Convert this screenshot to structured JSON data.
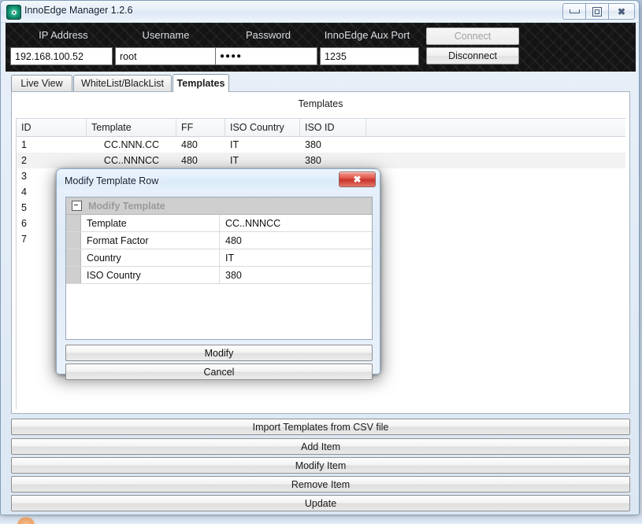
{
  "window": {
    "title": "InnoEdge Manager 1.2.6",
    "icon": "eye-icon",
    "controls": {
      "minimize": "minimize-icon",
      "maximize": "restore-icon",
      "close": "close-icon"
    }
  },
  "connection": {
    "fields": [
      {
        "label": "IP Address",
        "value": "192.168.100.52",
        "name": "ip-address"
      },
      {
        "label": "Username",
        "value": "root",
        "name": "username"
      },
      {
        "label": "Password",
        "value": "●●●●",
        "name": "password"
      },
      {
        "label": "InnoEdge Aux Port",
        "value": "1235",
        "name": "aux-port"
      }
    ],
    "connect_label": "Connect",
    "connect_enabled": false,
    "disconnect_label": "Disconnect",
    "disconnect_enabled": true
  },
  "tabs": [
    {
      "label": "Live View",
      "active": false
    },
    {
      "label": "WhiteList/BlackList",
      "active": false
    },
    {
      "label": "Templates",
      "active": true
    }
  ],
  "templates_panel": {
    "caption": "Templates",
    "columns": [
      "ID",
      "Template",
      "FF",
      "ISO Country",
      "ISO ID",
      ""
    ],
    "rows": [
      {
        "id": "1",
        "template": "CC.NNN.CC",
        "ff": "480",
        "iso_country": "IT",
        "iso_id": "380",
        "selected": false
      },
      {
        "id": "2",
        "template": "CC..NNNCC",
        "ff": "480",
        "iso_country": "IT",
        "iso_id": "380",
        "selected": true
      },
      {
        "id": "3",
        "template": "",
        "ff": "",
        "iso_country": "",
        "iso_id": "",
        "selected": false
      },
      {
        "id": "4",
        "template": "",
        "ff": "",
        "iso_country": "",
        "iso_id": "",
        "selected": false
      },
      {
        "id": "5",
        "template": "",
        "ff": "",
        "iso_country": "",
        "iso_id": "",
        "selected": false
      },
      {
        "id": "6",
        "template": "",
        "ff": "",
        "iso_country": "",
        "iso_id": "",
        "selected": false
      },
      {
        "id": "7",
        "template": "",
        "ff": "",
        "iso_country": "",
        "iso_id": "",
        "selected": false
      }
    ]
  },
  "actions": [
    {
      "label": "Import Templates from CSV file",
      "name": "import-templates-button"
    },
    {
      "label": "Add Item",
      "name": "add-item-button"
    },
    {
      "label": "Modify Item",
      "name": "modify-item-button"
    },
    {
      "label": "Remove Item",
      "name": "remove-item-button"
    },
    {
      "label": "Update",
      "name": "update-button"
    }
  ],
  "dialog": {
    "title": "Modify Template Row",
    "close_label": "✖",
    "category": "Modify Template",
    "properties": [
      {
        "name": "Template",
        "value": "CC..NNNCC"
      },
      {
        "name": "Format Factor",
        "value": "480"
      },
      {
        "name": "Country",
        "value": "IT"
      },
      {
        "name": "ISO Country",
        "value": "380"
      }
    ],
    "modify_label": "Modify",
    "cancel_label": "Cancel"
  },
  "colors": {
    "accent": "#2b5a8c",
    "close_red": "#c8332a",
    "plate_dark": "#141414",
    "selected_row": "#f2f2f2"
  }
}
